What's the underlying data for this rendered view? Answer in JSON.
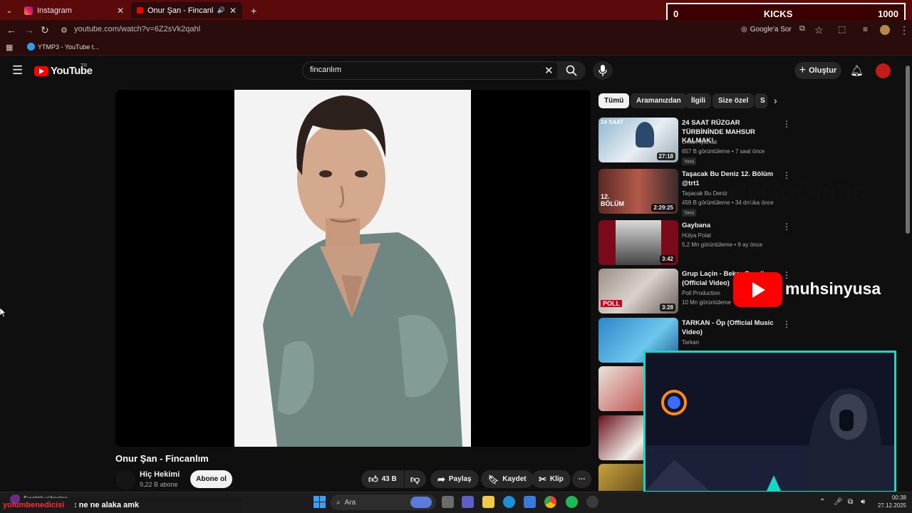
{
  "browser": {
    "tabs": [
      {
        "title": "Instagram"
      },
      {
        "title": "Onur Şan - Fincanlım - You"
      }
    ],
    "new_tab": "+",
    "url": "youtube.com/watch?v=6Z2sVk2qahl",
    "google_lens": "Google'a Sor",
    "bookmark": "YTMP3 - YouTube t..."
  },
  "kicks": {
    "left": "0",
    "label": "KICKS",
    "right": "1000"
  },
  "youtube": {
    "logo": "YouTube",
    "region": "TR",
    "search_value": "fincanlım",
    "create_label": "Oluştur"
  },
  "video": {
    "title": "Onur Şan - Fincanlım",
    "channel": "Hiç Hekimi",
    "subscribers": "9,22 B abone",
    "subscribe_label": "Abone ol",
    "likes": "43 B",
    "share_label": "Paylaş",
    "save_label": "Kaydet",
    "clip_label": "Klip"
  },
  "chips": [
    "Tümü",
    "Aramanızdan",
    "İlgili",
    "Size özel",
    "S"
  ],
  "recommendations": [
    {
      "title": "24 SAAT RÜZGAR TÜRBİNİNDE MAHSUR KALMAK!",
      "channel": "Orkun Işıtmak",
      "meta": "657 B görüntüleme • 7 saat önce",
      "badge": "Yeni",
      "duration": "27:18",
      "thumb_text": "24 SAAT"
    },
    {
      "title": "Taşacak Bu Deniz 12. Bölüm @trt1",
      "channel": "Taşacak Bu Deniz",
      "meta": "459 B görüntüleme • 34 dakika önce",
      "badge": "Yeni",
      "duration": "2:29:25",
      "thumb_text": "12. BÖLÜM"
    },
    {
      "title": "Gaybana",
      "channel": "Hülya Polat",
      "meta": "5,2 Mn görüntüleme • 9 ay önce",
      "badge": "",
      "duration": "3:42",
      "thumb_text": ""
    },
    {
      "title": "Grup Laçin - Bekar Gezelim (Official Video)",
      "channel": "Poll Production",
      "meta": "10 Mn görüntüleme",
      "badge": "",
      "duration": "3:28",
      "thumb_text": "POLL"
    },
    {
      "title": "TARKAN - Öp (Official Music Video)",
      "channel": "Tarkan",
      "meta": "",
      "badge": "",
      "duration": "",
      "thumb_text": ""
    }
  ],
  "overlays": {
    "bynogame": "ByNoGame",
    "channel_name": "muhsinyusa"
  },
  "chat": {
    "user": "yolumbenedicisi",
    "message": ": ne ne alaka amk"
  },
  "taskbar": {
    "weather": "Sıcaklık yükselec...",
    "search_label": "Ara",
    "time": "00:38",
    "date": "27.12.2025"
  }
}
